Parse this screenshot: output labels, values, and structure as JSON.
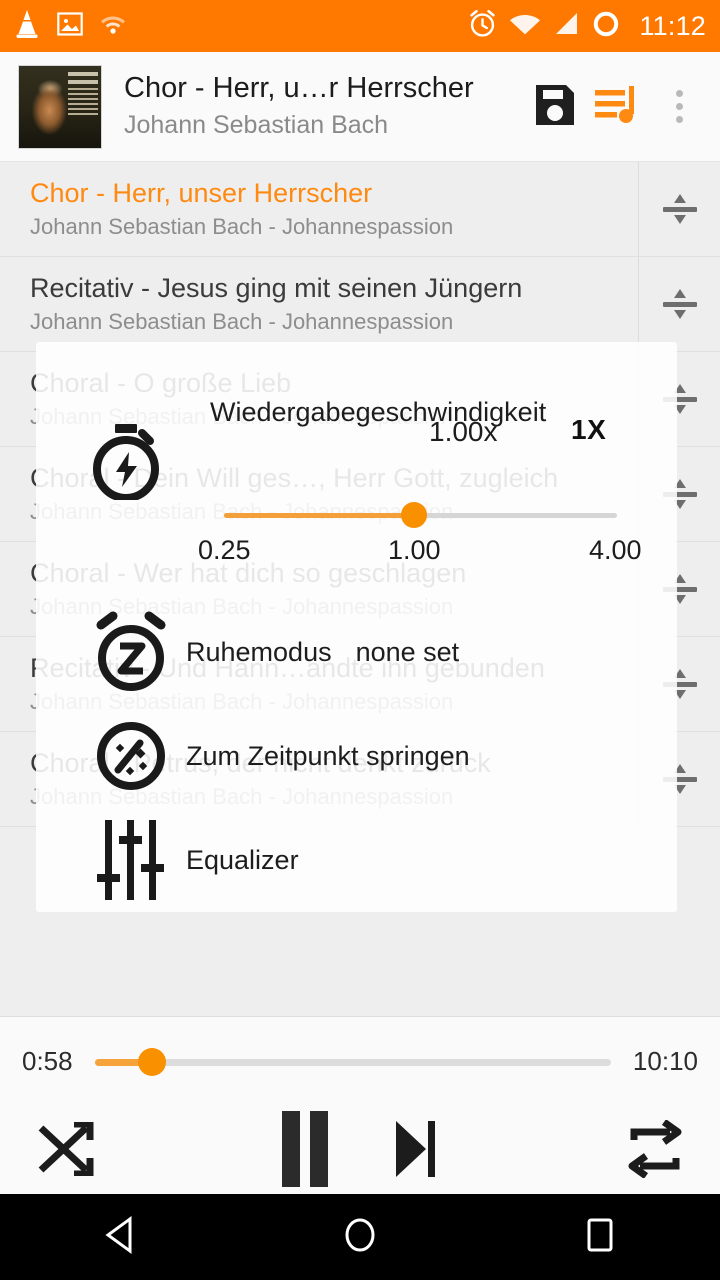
{
  "statusbar": {
    "time": "11:12",
    "icons": [
      "vlc-cone-icon",
      "screenshot-icon",
      "wifi-weak-icon",
      "alarm-icon",
      "wifi-icon",
      "signal-icon",
      "battery-icon"
    ]
  },
  "titlebar": {
    "track_title": "Chor - Herr, u…r Herrscher",
    "artist": "Johann Sebastian Bach",
    "save_label": "save-icon",
    "queue_label": "playlist-queue-icon",
    "overflow_label": "overflow-menu-icon"
  },
  "playlist": {
    "rows": [
      {
        "title": "Chor - Herr, unser Herrscher",
        "subtitle": "Johann Sebastian Bach - Johannespassion",
        "current": true
      },
      {
        "title": "Recitativ - Jesus ging mit seinen Jüngern",
        "subtitle": "Johann Sebastian Bach - Johannespassion",
        "current": false
      },
      {
        "title": "Choral - O große Lieb",
        "subtitle": "Johann Sebastian Bach - Johannespassion",
        "current": false
      },
      {
        "title": "Choral - Dein Will ges…, Herr Gott, zugleich",
        "subtitle": "Johann Sebastian Bach - Johannespassion",
        "current": false
      },
      {
        "title": "Choral - Wer hat dich so geschlagen",
        "subtitle": "Johann Sebastian Bach - Johannespassion",
        "current": false
      },
      {
        "title": "Recitativ - Und Hann…andte ihn gebunden",
        "subtitle": "Johann Sebastian Bach - Johannespassion",
        "current": false
      },
      {
        "title": "Choral - Petrus, der nicht denkt zurück",
        "subtitle": "Johann Sebastian Bach - Johannespassion",
        "current": false
      }
    ]
  },
  "dialog": {
    "speed": {
      "label": "Wiedergabegeschwindigkeit",
      "value": "1.00x",
      "reset_label": "1X",
      "tick_min": "0.25",
      "tick_mid": "1.00",
      "tick_max": "4.00"
    },
    "items": [
      {
        "label": "Ruhemodus",
        "value": "none set",
        "icon": "sleep-timer-icon"
      },
      {
        "label": "Zum Zeitpunkt springen",
        "value": "",
        "icon": "jump-to-time-icon"
      },
      {
        "label": "Equalizer",
        "value": "",
        "icon": "equalizer-icon"
      }
    ]
  },
  "player": {
    "elapsed": "0:58",
    "total": "10:10",
    "progress_percent": 9,
    "shuffle_label": "shuffle-icon",
    "pause_label": "pause-icon",
    "next_label": "next-track-icon",
    "repeat_label": "repeat-icon"
  },
  "navbar": {
    "back_label": "back-nav-icon",
    "home_label": "home-nav-icon",
    "recents_label": "recents-nav-icon"
  },
  "colors": {
    "status_orange": "#ff7800",
    "accent_orange": "#f99000",
    "current_track": "#ff8a12",
    "list_bg": "#eeeeee"
  }
}
